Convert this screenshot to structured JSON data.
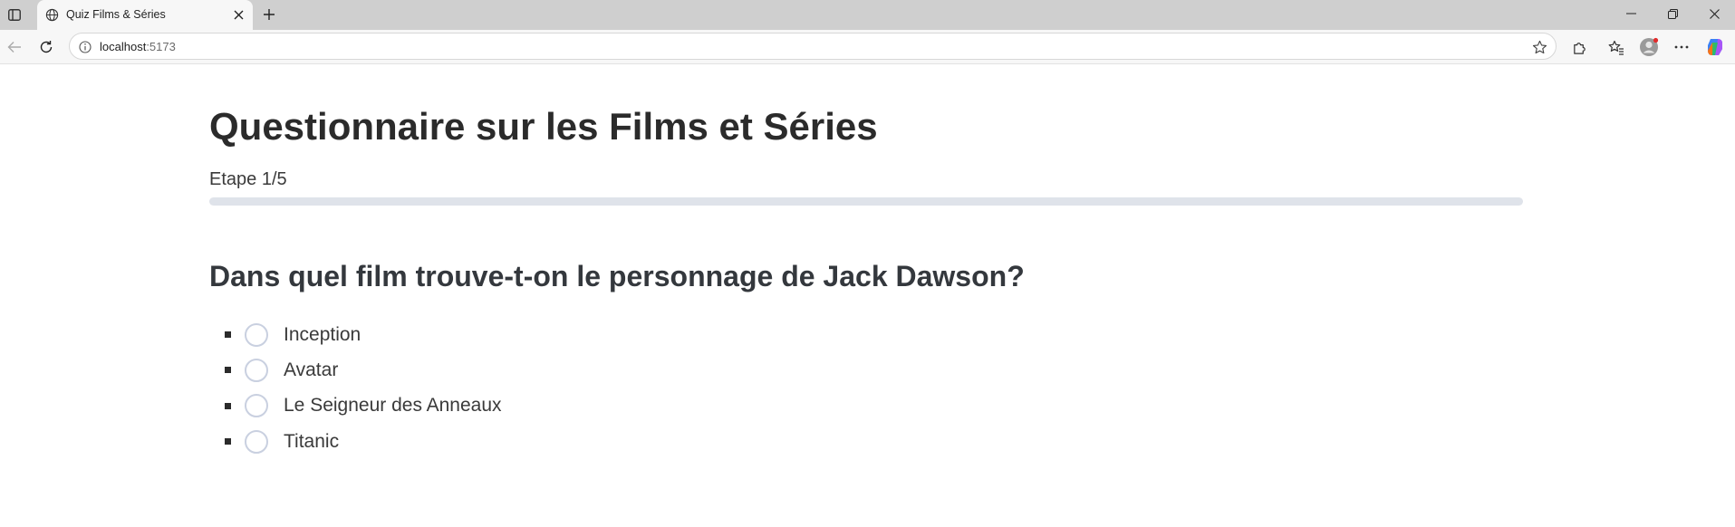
{
  "browser": {
    "tab": {
      "title": "Quiz Films & Séries",
      "favicon": "globe-icon"
    },
    "address_bar": {
      "host": "localhost",
      "port": ":5173"
    },
    "icons": {
      "sidebar": "sidebar-toggle-icon",
      "close_tab": "close-icon",
      "new_tab": "plus-icon",
      "minimize": "minimize-icon",
      "restore": "restore-icon",
      "close_window": "close-icon",
      "back": "back-arrow-icon",
      "refresh": "refresh-icon",
      "site_info": "info-icon",
      "favorite": "star-icon",
      "extensions": "puzzle-icon",
      "favorites": "favorites-icon",
      "profile": "profile-icon",
      "menu": "more-icon",
      "copilot": "copilot-icon"
    }
  },
  "quiz": {
    "title": "Questionnaire sur les Films et Séries",
    "step_label": "Etape 1/5",
    "progress_fraction": 0,
    "question": "Dans quel film trouve-t-on le personnage de Jack Dawson?",
    "options": [
      "Inception",
      "Avatar",
      "Le Seigneur des Anneaux",
      "Titanic"
    ]
  },
  "colors": {
    "progress_track": "#dfe3ea",
    "radio_border": "#c9d0e0",
    "heading_text": "#2b2b2b"
  }
}
